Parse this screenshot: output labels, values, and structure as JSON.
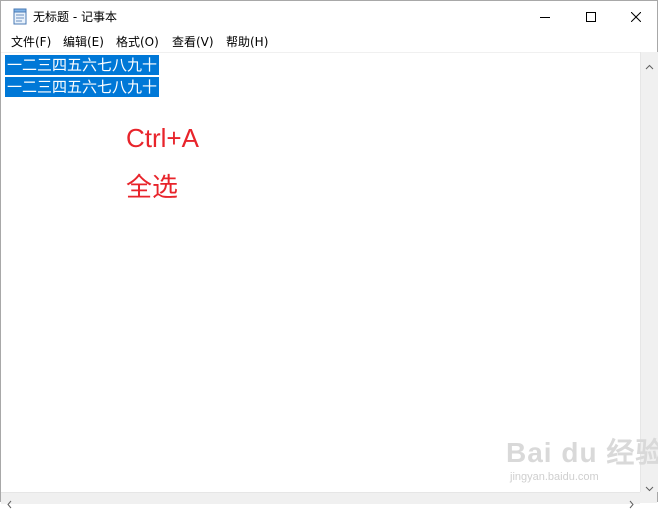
{
  "window": {
    "title": "无标题 - 记事本",
    "icons": {
      "app": "notepad-icon",
      "minimize": "minimize-icon",
      "maximize": "maximize-icon",
      "close": "close-icon"
    }
  },
  "menu": {
    "items": [
      "文件(F)",
      "编辑(E)",
      "格式(O)",
      "查看(V)",
      "帮助(H)"
    ]
  },
  "editor": {
    "lines": [
      "一二三四五六七八九十",
      "一二三四五六七八九十"
    ],
    "selection_color": "#0078d7"
  },
  "annotation": {
    "shortcut": "Ctrl+A",
    "action": "全选",
    "color": "#e8242b"
  },
  "watermark": {
    "brand": "Bai du 经验",
    "url": "jingyan.baidu.com"
  }
}
